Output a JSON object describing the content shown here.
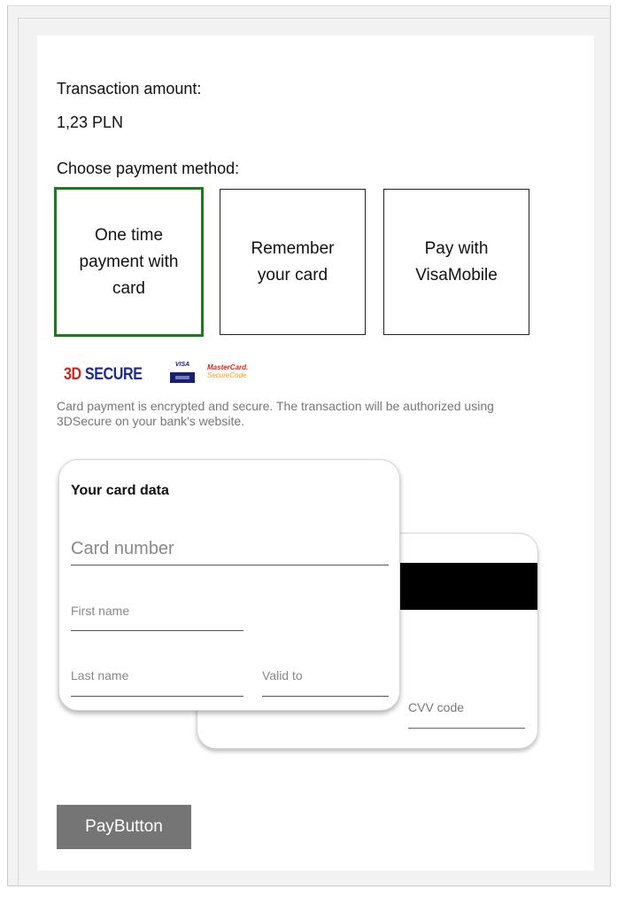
{
  "transaction": {
    "label": "Transaction amount:",
    "amount": "1,23 PLN"
  },
  "payment_methods": {
    "label": "Choose payment method:",
    "selected": "One time payment with card",
    "selected_color": "#1c7a1c",
    "items": [
      {
        "label": "One time payment with card"
      },
      {
        "label": "Remember your card"
      },
      {
        "label": "Pay with VisaMobile"
      }
    ]
  },
  "security": {
    "logos": {
      "secure_3d_prefix": "3D",
      "secure_3d_suffix": "SECURE",
      "visa_text": "VISA",
      "mastercard_line1": "MasterCard.",
      "mastercard_line2": "SecureCode"
    },
    "note": "Card payment is encrypted and secure. The transaction will be authorized using 3DSecure on your bank's website."
  },
  "card_form": {
    "title": "Your card data",
    "card_number_placeholder": "Card number",
    "first_name_placeholder": "First name",
    "last_name_placeholder": "Last name",
    "valid_to_placeholder": "Valid to",
    "cvv_placeholder": "CVV code"
  },
  "pay_button": {
    "label": "PayButton",
    "color": "#757575"
  }
}
